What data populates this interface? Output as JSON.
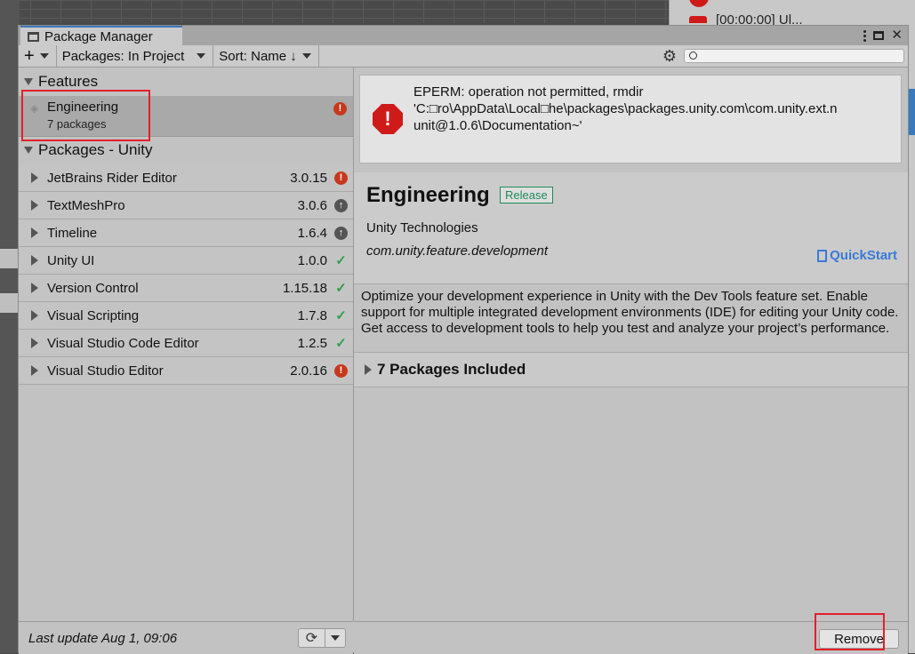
{
  "window": {
    "tab_title": "Package Manager"
  },
  "toolbar": {
    "add_label": "+",
    "packages_filter": "Packages: In Project",
    "sort": "Sort: Name ↓",
    "search_placeholder": ""
  },
  "features_section": {
    "title": "Features",
    "items": [
      {
        "name": "Engineering",
        "subtitle": "7 packages",
        "status": "error"
      }
    ]
  },
  "packages_section": {
    "title": "Packages - Unity",
    "items": [
      {
        "name": "JetBrains Rider Editor",
        "version": "3.0.15",
        "status": "error"
      },
      {
        "name": "TextMeshPro",
        "version": "3.0.6",
        "status": "update"
      },
      {
        "name": "Timeline",
        "version": "1.6.4",
        "status": "update"
      },
      {
        "name": "Unity UI",
        "version": "1.0.0",
        "status": "ok"
      },
      {
        "name": "Version Control",
        "version": "1.15.18",
        "status": "ok"
      },
      {
        "name": "Visual Scripting",
        "version": "1.7.8",
        "status": "ok"
      },
      {
        "name": "Visual Studio Code Editor",
        "version": "1.2.5",
        "status": "ok"
      },
      {
        "name": "Visual Studio Editor",
        "version": "2.0.16",
        "status": "error"
      }
    ]
  },
  "footer": {
    "last_update": "Last update Aug 1, 09:06"
  },
  "error": {
    "line1": "EPERM: operation not permitted, rmdir",
    "line2": "'C:□ro\\AppData\\Local□he\\packages\\packages.unity.com\\com.unity.ext.n",
    "line3": "unit@1.0.6\\Documentation~'"
  },
  "details": {
    "title": "Engineering",
    "badge": "Release",
    "author": "Unity Technologies",
    "package_id": "com.unity.feature.development",
    "quickstart": "QuickStart",
    "description": "Optimize your development experience in Unity with the Dev Tools feature set. Enable support for multiple integrated development environments (IDE) for editing your Unity code. Get access to development tools to help you test and analyze your project’s performance.",
    "included": "7 Packages Included",
    "remove": "Remove"
  },
  "background": {
    "console_text": "[00:00:00] Ul..."
  },
  "colors": {
    "accent": "#3a79bb",
    "error": "#c8381d",
    "ok": "#2f9e4d",
    "release": "#1e8a5a",
    "annotation": "#e3202a"
  }
}
